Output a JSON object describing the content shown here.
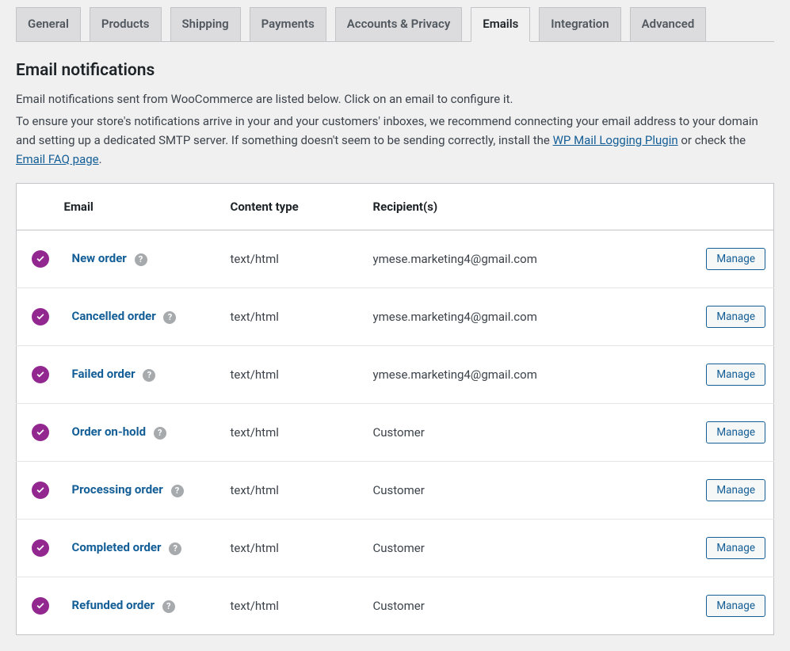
{
  "tabs": [
    {
      "label": "General"
    },
    {
      "label": "Products"
    },
    {
      "label": "Shipping"
    },
    {
      "label": "Payments"
    },
    {
      "label": "Accounts & Privacy"
    },
    {
      "label": "Emails",
      "active": true
    },
    {
      "label": "Integration"
    },
    {
      "label": "Advanced"
    }
  ],
  "section": {
    "title": "Email notifications",
    "desc1": "Email notifications sent from WooCommerce are listed below. Click on an email to configure it.",
    "desc2_pre": "To ensure your store's notifications arrive in your and your customers' inboxes, we recommend connecting your email address to your domain and setting up a dedicated SMTP server. If something doesn't seem to be sending correctly, install the ",
    "link1": "WP Mail Logging Plugin",
    "desc2_mid": " or check the ",
    "link2": "Email FAQ page",
    "desc2_post": "."
  },
  "table": {
    "headers": {
      "email": "Email",
      "content_type": "Content type",
      "recipients": "Recipient(s)"
    },
    "manage_label": "Manage",
    "rows": [
      {
        "name": "New order",
        "type": "text/html",
        "recipient": "ymese.marketing4@gmail.com"
      },
      {
        "name": "Cancelled order",
        "type": "text/html",
        "recipient": "ymese.marketing4@gmail.com"
      },
      {
        "name": "Failed order",
        "type": "text/html",
        "recipient": "ymese.marketing4@gmail.com"
      },
      {
        "name": "Order on-hold",
        "type": "text/html",
        "recipient": "Customer"
      },
      {
        "name": "Processing order",
        "type": "text/html",
        "recipient": "Customer"
      },
      {
        "name": "Completed order",
        "type": "text/html",
        "recipient": "Customer"
      },
      {
        "name": "Refunded order",
        "type": "text/html",
        "recipient": "Customer"
      }
    ]
  }
}
